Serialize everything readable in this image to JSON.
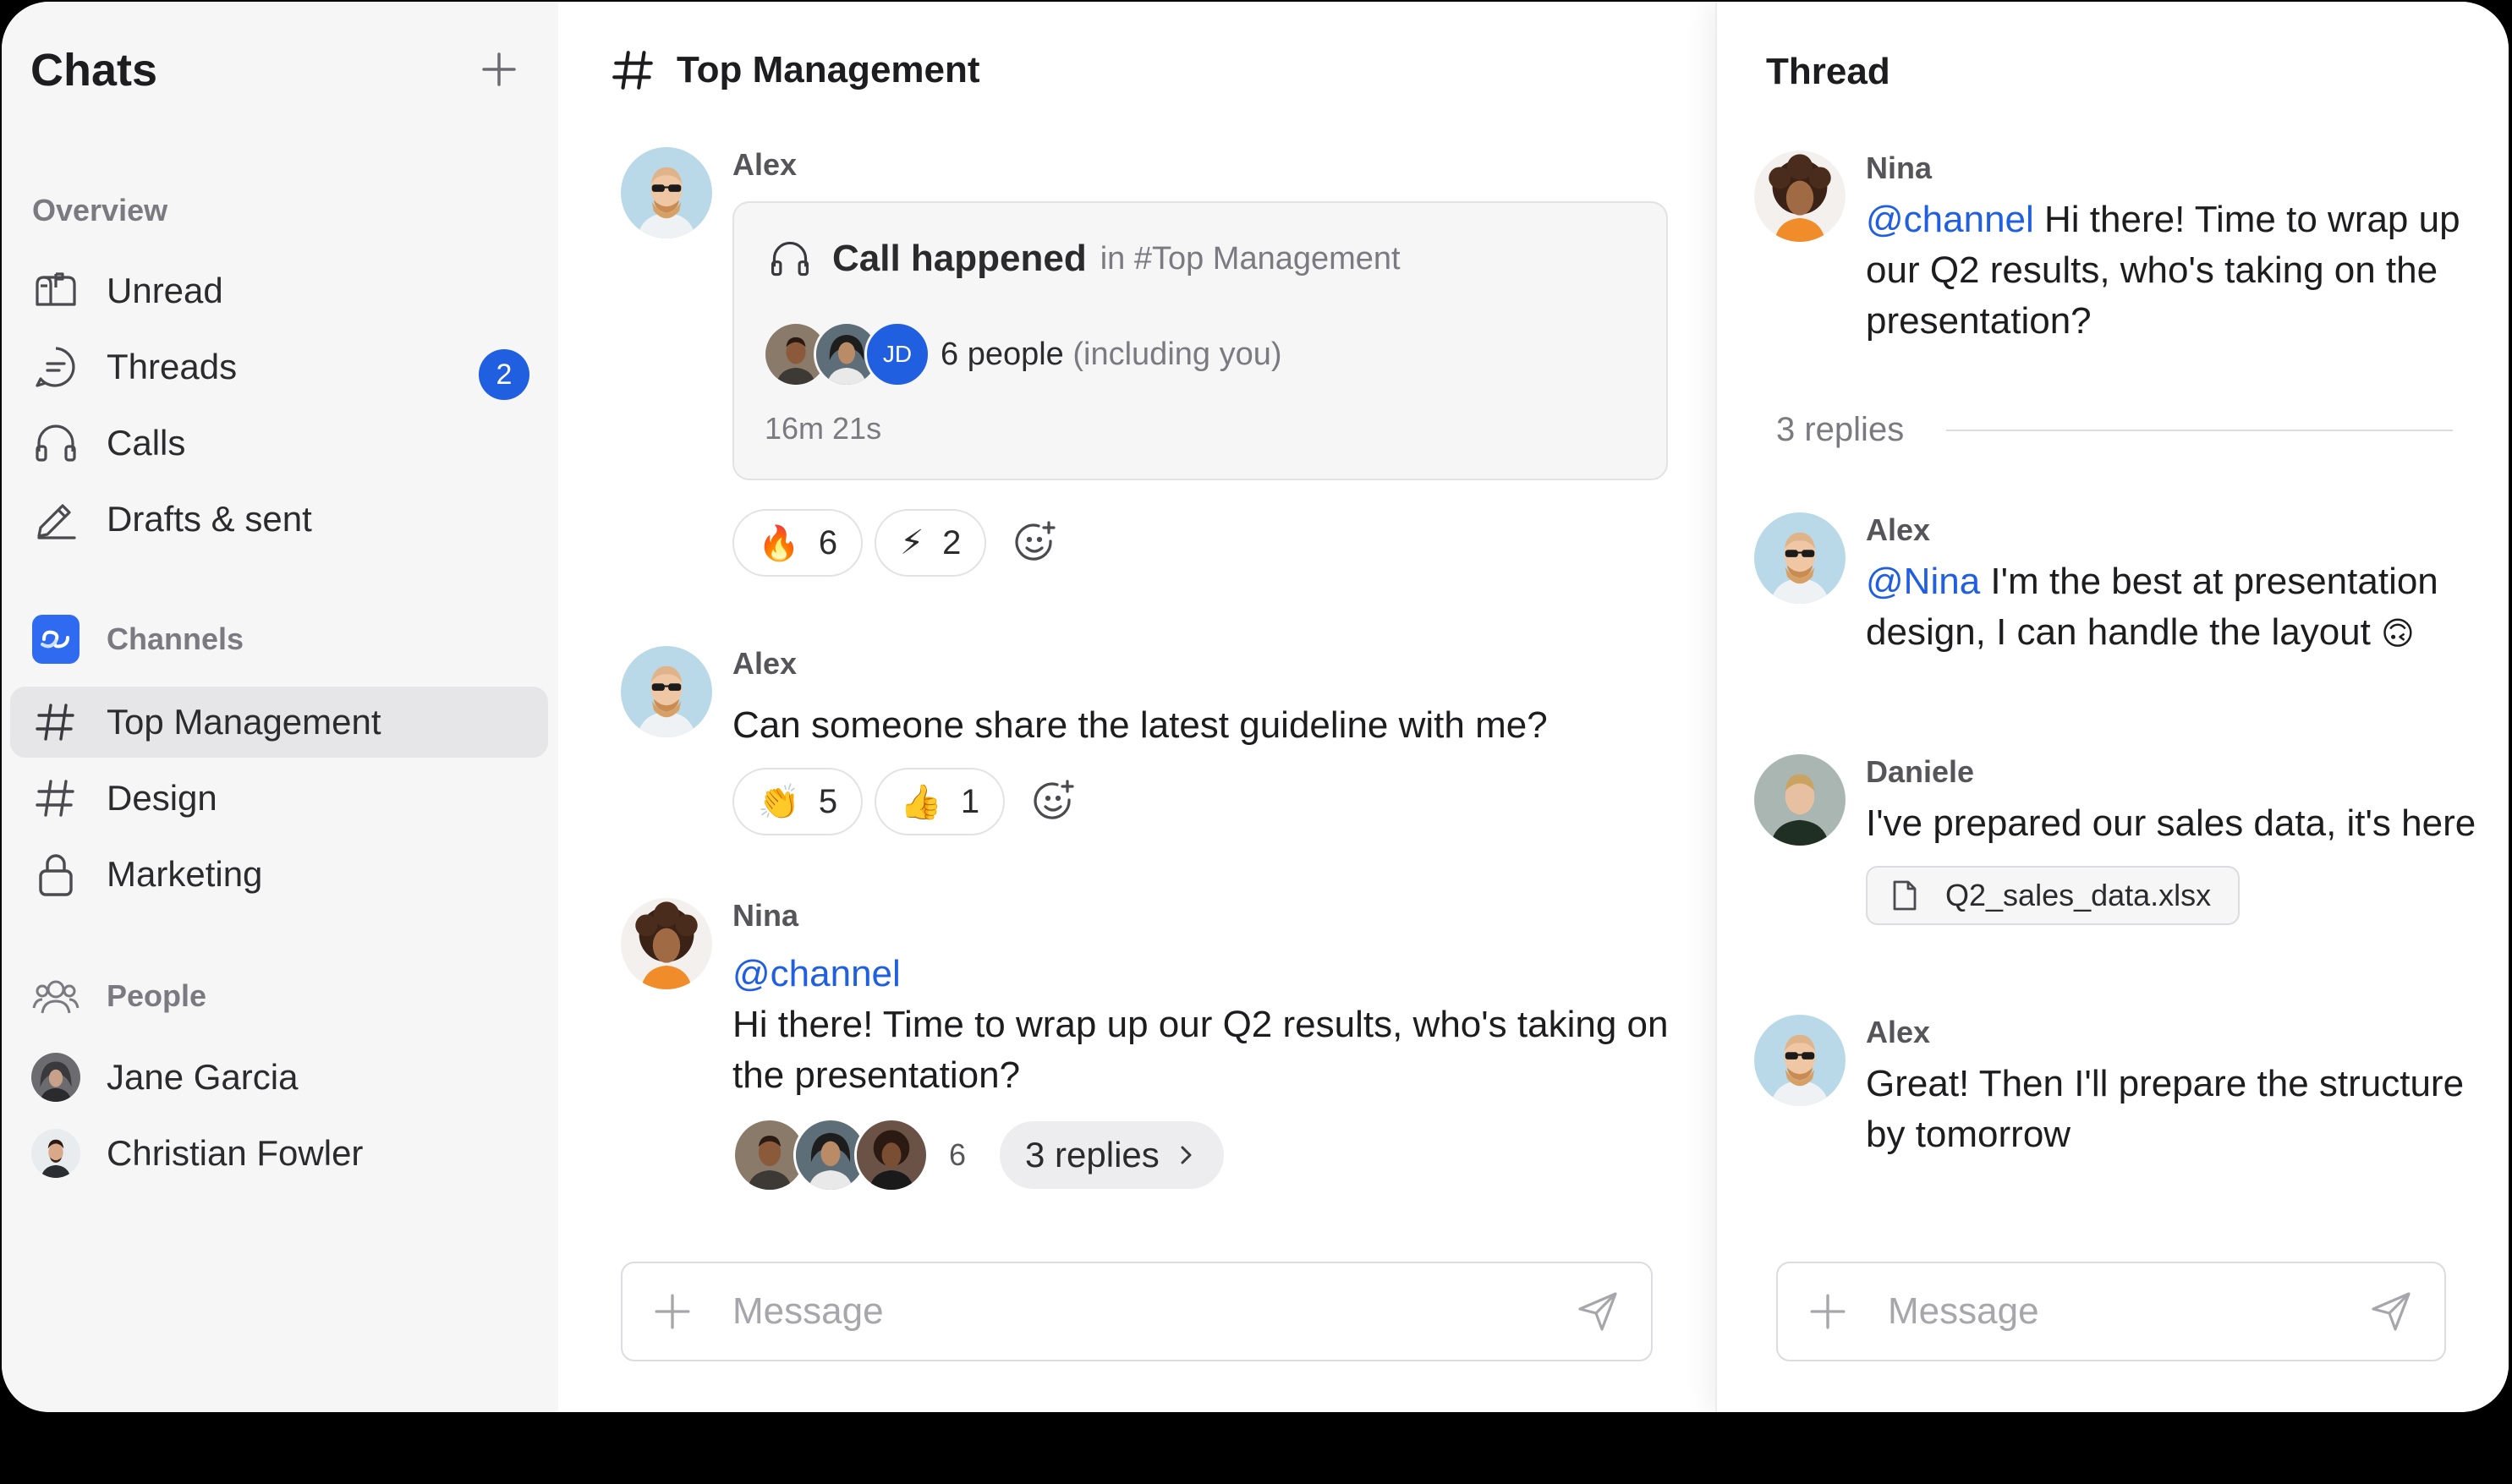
{
  "sidebar": {
    "title": "Chats",
    "overview_label": "Overview",
    "items": [
      {
        "label": "Unread"
      },
      {
        "label": "Threads",
        "badge": "2"
      },
      {
        "label": "Calls"
      },
      {
        "label": "Drafts & sent"
      }
    ],
    "channels_label": "Channels",
    "channels": [
      {
        "label": "Top Management",
        "active": true
      },
      {
        "label": "Design"
      },
      {
        "label": "Marketing"
      }
    ],
    "people_label": "People",
    "people": [
      {
        "label": "Jane Garcia"
      },
      {
        "label": "Christian Fowler"
      }
    ]
  },
  "main": {
    "channel_title": "Top Management",
    "messages": [
      {
        "author": "Alex",
        "call": {
          "title": "Call happened",
          "location": "in #Top Management",
          "avatar_initials": "JD",
          "people_count": "6 people",
          "people_note": "(including you)",
          "duration": "16m 21s"
        },
        "reactions": [
          {
            "emoji": "🔥",
            "count": "6"
          },
          {
            "emoji": "⚡",
            "count": "2"
          }
        ]
      },
      {
        "author": "Alex",
        "text": "Can someone share the latest guideline with me?",
        "reactions": [
          {
            "emoji": "👏",
            "count": "5"
          },
          {
            "emoji": "👍",
            "count": "1"
          }
        ]
      },
      {
        "author": "Nina",
        "mention": "@channel",
        "text": "Hi there! Time to wrap up our Q2 results, who's taking on the presentation?",
        "thread_participants": "6",
        "replies_label": "3 replies"
      }
    ],
    "composer_placeholder": "Message"
  },
  "thread": {
    "title": "Thread",
    "root": {
      "author": "Nina",
      "mention": "@channel",
      "text": "Hi there! Time to wrap up our Q2 results, who's taking on the presentation?"
    },
    "replies_label": "3 replies",
    "replies": [
      {
        "author": "Alex",
        "mention": "@Nina",
        "text": "I'm the best at presentation design, I can handle the layout",
        "emoji": "🙃"
      },
      {
        "author": "Daniele",
        "text": "I've prepared our sales data, it's here",
        "file": "Q2_sales_data.xlsx"
      },
      {
        "author": "Alex",
        "text": "Great! Then I'll prepare the structure by tomorrow"
      }
    ],
    "composer_placeholder": "Message"
  },
  "colors": {
    "accent": "#1f5fe0",
    "sidebar_bg": "#f6f6f7",
    "active_item_bg": "#e6e6e8",
    "mention": "#1f5fe0"
  },
  "icons": [
    "plus-icon",
    "unread-icon",
    "threads-icon",
    "calls-icon",
    "drafts-icon",
    "channels-logo-icon",
    "hash-icon",
    "lock-icon",
    "people-icon",
    "headphones-icon",
    "add-reaction-icon",
    "chevron-right-icon",
    "send-icon",
    "file-icon"
  ]
}
